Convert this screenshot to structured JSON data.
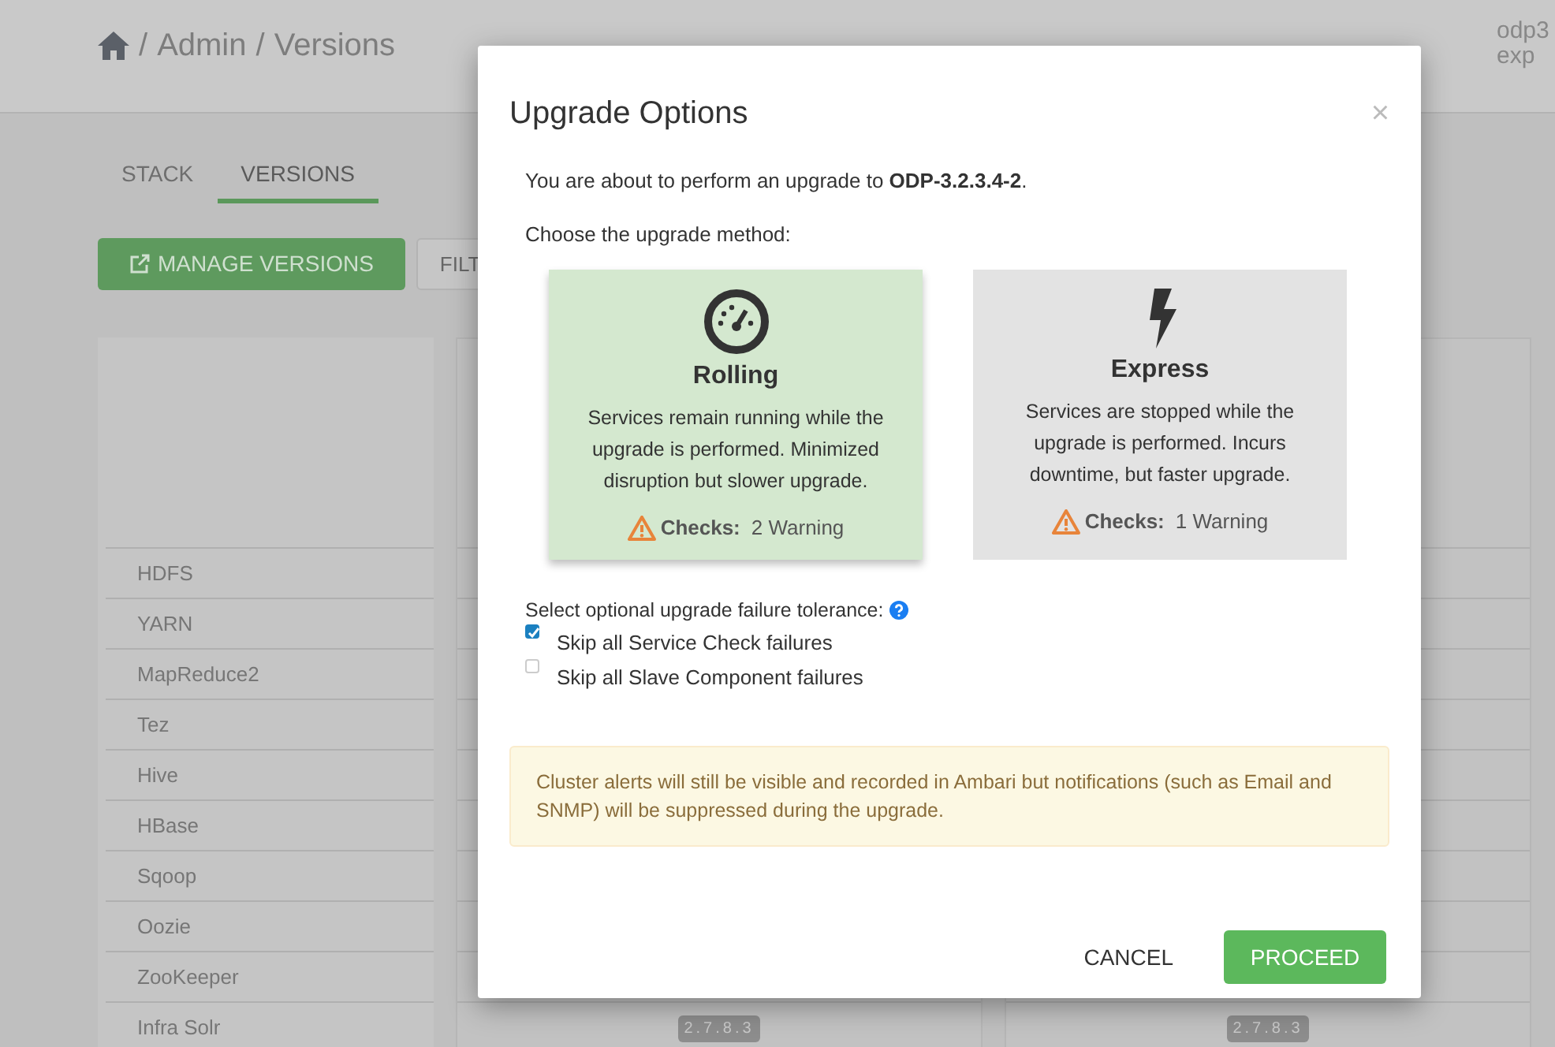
{
  "page": {
    "breadcrumb": [
      {
        "separator": "/",
        "label": "Admin"
      },
      {
        "separator": "/",
        "label": "Versions"
      }
    ],
    "user": [
      "odp3",
      "exp"
    ],
    "tabs": [
      {
        "label": "STACK",
        "selected": false
      },
      {
        "label": "VERSIONS",
        "selected": true
      }
    ],
    "manage_button": "MANAGE VERSIONS",
    "filter_button": "FILT",
    "services": [
      {
        "name": "HDFS"
      },
      {
        "name": "YARN"
      },
      {
        "name": "MapReduce2"
      },
      {
        "name": "Tez"
      },
      {
        "name": "Hive"
      },
      {
        "name": "HBase"
      },
      {
        "name": "Sqoop"
      },
      {
        "name": "Oozie"
      },
      {
        "name": "ZooKeeper"
      },
      {
        "name": "Infra Solr",
        "badges": [
          "2.7.8.3",
          "2.7.8.3"
        ]
      }
    ]
  },
  "modal": {
    "title": "Upgrade Options",
    "close": "×",
    "intro": "You are about to perform an upgrade to **ODP-3.2.3.4-2**.",
    "choose": "Choose the upgrade method:",
    "options": [
      {
        "kind": "rolling",
        "title": "Rolling",
        "description": "Services remain running while the upgrade is performed. Minimized disruption but slower upgrade.",
        "checks_label": "Checks:",
        "checks_value": "2 Warning",
        "selected": true
      },
      {
        "kind": "express",
        "title": "Express",
        "description": "Services are stopped while the upgrade is performed. Incurs downtime, but faster upgrade.",
        "checks_label": "Checks:",
        "checks_value": "1 Warning",
        "selected": false
      }
    ],
    "tolerance_label": "Select optional upgrade failure tolerance:",
    "tolerance_options": [
      {
        "label": "Skip all Service Check failures",
        "checked": true
      },
      {
        "label": "Skip all Slave Component failures",
        "checked": false
      }
    ],
    "alert": "Cluster alerts will still be visible and recorded in Ambari but notifications (such as Email and SNMP) will be suppressed during the upgrade.",
    "buttons": [
      {
        "kind": "cancel",
        "label": "CANCEL"
      },
      {
        "kind": "proceed",
        "label": "PROCEED"
      }
    ]
  }
}
